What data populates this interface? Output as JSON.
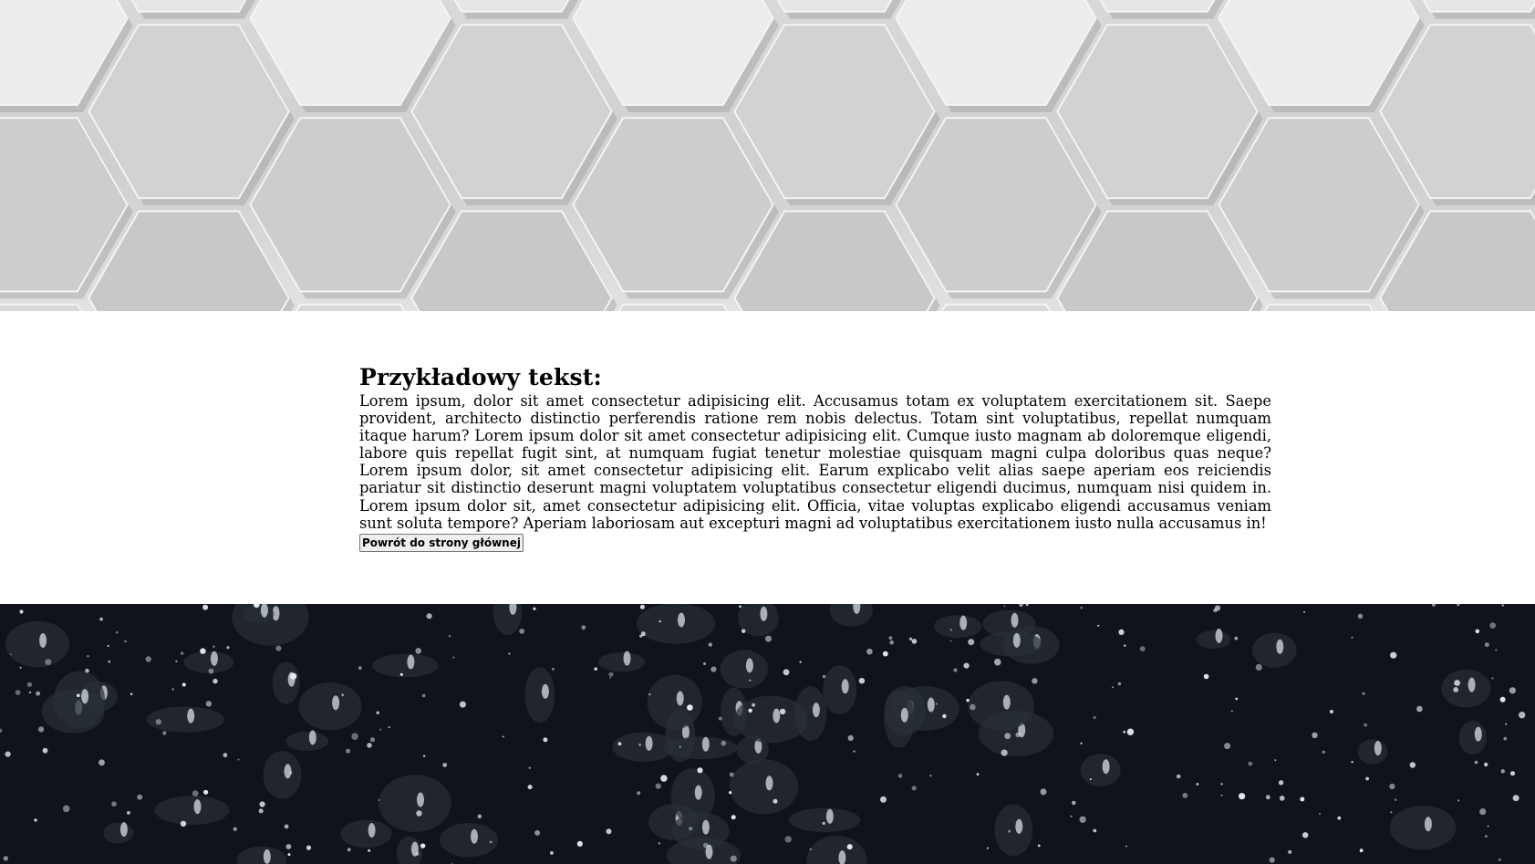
{
  "content": {
    "heading": "Przykładowy tekst:",
    "body": "Lorem ipsum, dolor sit amet consectetur adipisicing elit. Accusamus totam ex voluptatem exercitationem sit. Saepe provident, architecto distinctio perferendis ratione rem nobis delectus. Totam sint voluptatibus, repellat numquam itaque harum? Lorem ipsum dolor sit amet consectetur adipisicing elit. Cumque iusto magnam ab doloremque eligendi, labore quis repellat fugit sint, at numquam fugiat tenetur molestiae quisquam magni culpa doloribus quas neque? Lorem ipsum dolor, sit amet consectetur adipisicing elit. Earum explicabo velit alias saepe aperiam eos reiciendis pariatur sit distinctio deserunt magni voluptatem voluptatibus consectetur eligendi ducimus, numquam nisi quidem in. Lorem ipsum dolor sit, amet consectetur adipisicing elit. Officia, vitae voluptas explicabo eligendi accusamus veniam sunt soluta tempore? Aperiam laboriosam aut excepturi magni ad voluptatibus exercitationem iusto nulla accusamus in!",
    "back_button_label": "Powrót do strony głównej"
  },
  "images": {
    "top_banner": "hexagon-pattern-image",
    "bottom_banner": "water-drops-image"
  },
  "colors": {
    "page_background": "#ffffff",
    "text": "#000000"
  }
}
